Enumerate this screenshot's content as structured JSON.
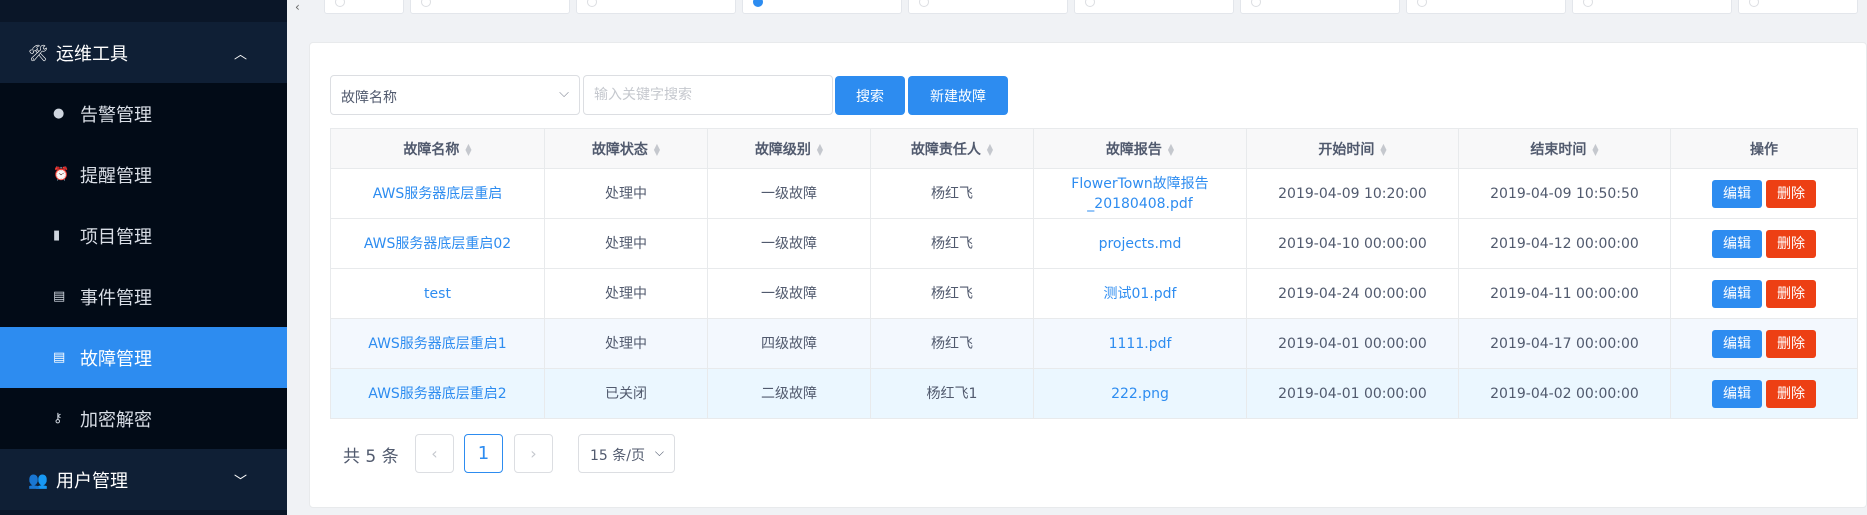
{
  "sidebar": {
    "ops_tools": {
      "label": "运维工具",
      "icon": "tools-icon",
      "chevron": "chevron-up-icon"
    },
    "items": [
      {
        "label": "告警管理",
        "icon": "alarm-icon"
      },
      {
        "label": "提醒管理",
        "icon": "reminder-icon"
      },
      {
        "label": "项目管理",
        "icon": "document-icon"
      },
      {
        "label": "事件管理",
        "icon": "book-icon"
      },
      {
        "label": "故障管理",
        "icon": "book-icon",
        "active": true
      },
      {
        "label": "加密解密",
        "icon": "key-icon"
      }
    ],
    "user_mgmt": {
      "label": "用户管理",
      "icon": "users-icon",
      "chevron": "chevron-down-icon"
    }
  },
  "toolbar": {
    "select_value": "故障名称",
    "search_placeholder": "输入关键字搜索",
    "search_label": "搜索",
    "new_label": "新建故障"
  },
  "table": {
    "headers": [
      "故障名称",
      "故障状态",
      "故障级别",
      "故障责任人",
      "故障报告",
      "开始时间",
      "结束时间",
      "操作"
    ],
    "rows": [
      {
        "name": "AWS服务器底层重启",
        "status": "处理中",
        "level": "一级故障",
        "owner": "杨红飞",
        "report": "FlowerTown故障报告_20180408.pdf",
        "start": "2019-04-09 10:20:00",
        "end": "2019-04-09 10:50:50"
      },
      {
        "name": "AWS服务器底层重启02",
        "status": "处理中",
        "level": "一级故障",
        "owner": "杨红飞",
        "report": "projects.md",
        "start": "2019-04-10 00:00:00",
        "end": "2019-04-12 00:00:00"
      },
      {
        "name": "test",
        "status": "处理中",
        "level": "一级故障",
        "owner": "杨红飞",
        "report": "测试01.pdf",
        "start": "2019-04-24 00:00:00",
        "end": "2019-04-11 00:00:00"
      },
      {
        "name": "AWS服务器底层重启1",
        "status": "处理中",
        "level": "四级故障",
        "owner": "杨红飞",
        "report": "1111.pdf",
        "start": "2019-04-01 00:00:00",
        "end": "2019-04-17 00:00:00"
      },
      {
        "name": "AWS服务器底层重启2",
        "status": "已关闭",
        "level": "二级故障",
        "owner": "杨红飞1",
        "report": "222.png",
        "start": "2019-04-01 00:00:00",
        "end": "2019-04-02 00:00:00"
      }
    ],
    "edit_label": "编辑",
    "delete_label": "删除"
  },
  "pagination": {
    "total_text": "共 5 条",
    "current_page": "1",
    "page_size": "15 条/页"
  },
  "colors": {
    "primary": "#2d8cf0",
    "danger": "#ed4014",
    "sidebar_bg": "#0a1628"
  }
}
